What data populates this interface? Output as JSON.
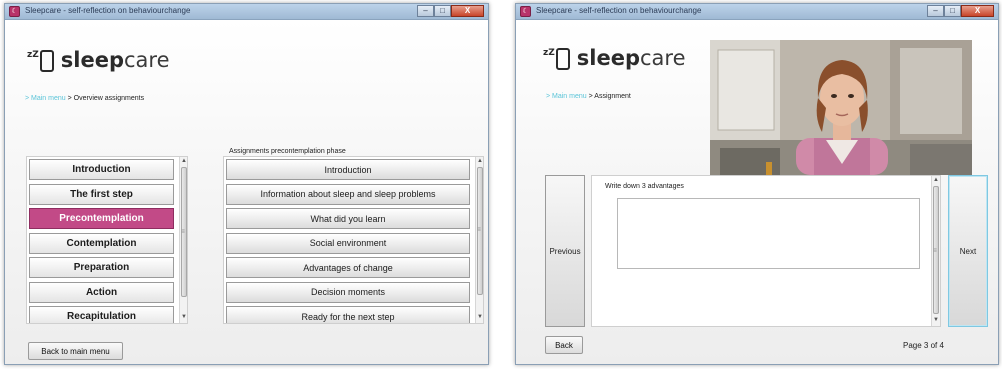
{
  "app": {
    "title": "Sleepcare - self-reflection on behaviourchange",
    "logo_prefix": "sleep",
    "logo_suffix": "care",
    "logo_zz": "zZ"
  },
  "overview_window": {
    "breadcrumb": {
      "link": "> Main menu",
      "current": "> Overview assignments"
    },
    "stages": [
      "Introduction",
      "The first step",
      "Precontemplation",
      "Contemplation",
      "Preparation",
      "Action",
      "Recapitulation"
    ],
    "selected_stage": "Precontemplation",
    "assignments_header": "Assignments precontemplation phase",
    "assignments": [
      "Introduction",
      "Information about sleep and sleep problems",
      "What did you learn",
      "Social environment",
      "Advantages of change",
      "Decision moments",
      "Ready for the next step"
    ],
    "back_button": "Back to main menu"
  },
  "assignment_window": {
    "breadcrumb": {
      "link": "> Main menu",
      "current": "> Assignment"
    },
    "prompt": "Write down 3 advantages",
    "answer_value": "",
    "previous_button": "Previous",
    "next_button": "Next",
    "back_button": "Back",
    "page_indicator": "Page 3 of 4"
  },
  "window_controls": {
    "minimize": "–",
    "maximize": "□",
    "close": "X"
  },
  "icons": {
    "app": "sleepcare-app-icon",
    "scroll_up": "▲",
    "scroll_down": "▼",
    "grip": "≡"
  },
  "colors": {
    "accent": "#c24a87",
    "link": "#5ac4d8",
    "focus": "#7fc8e2"
  }
}
